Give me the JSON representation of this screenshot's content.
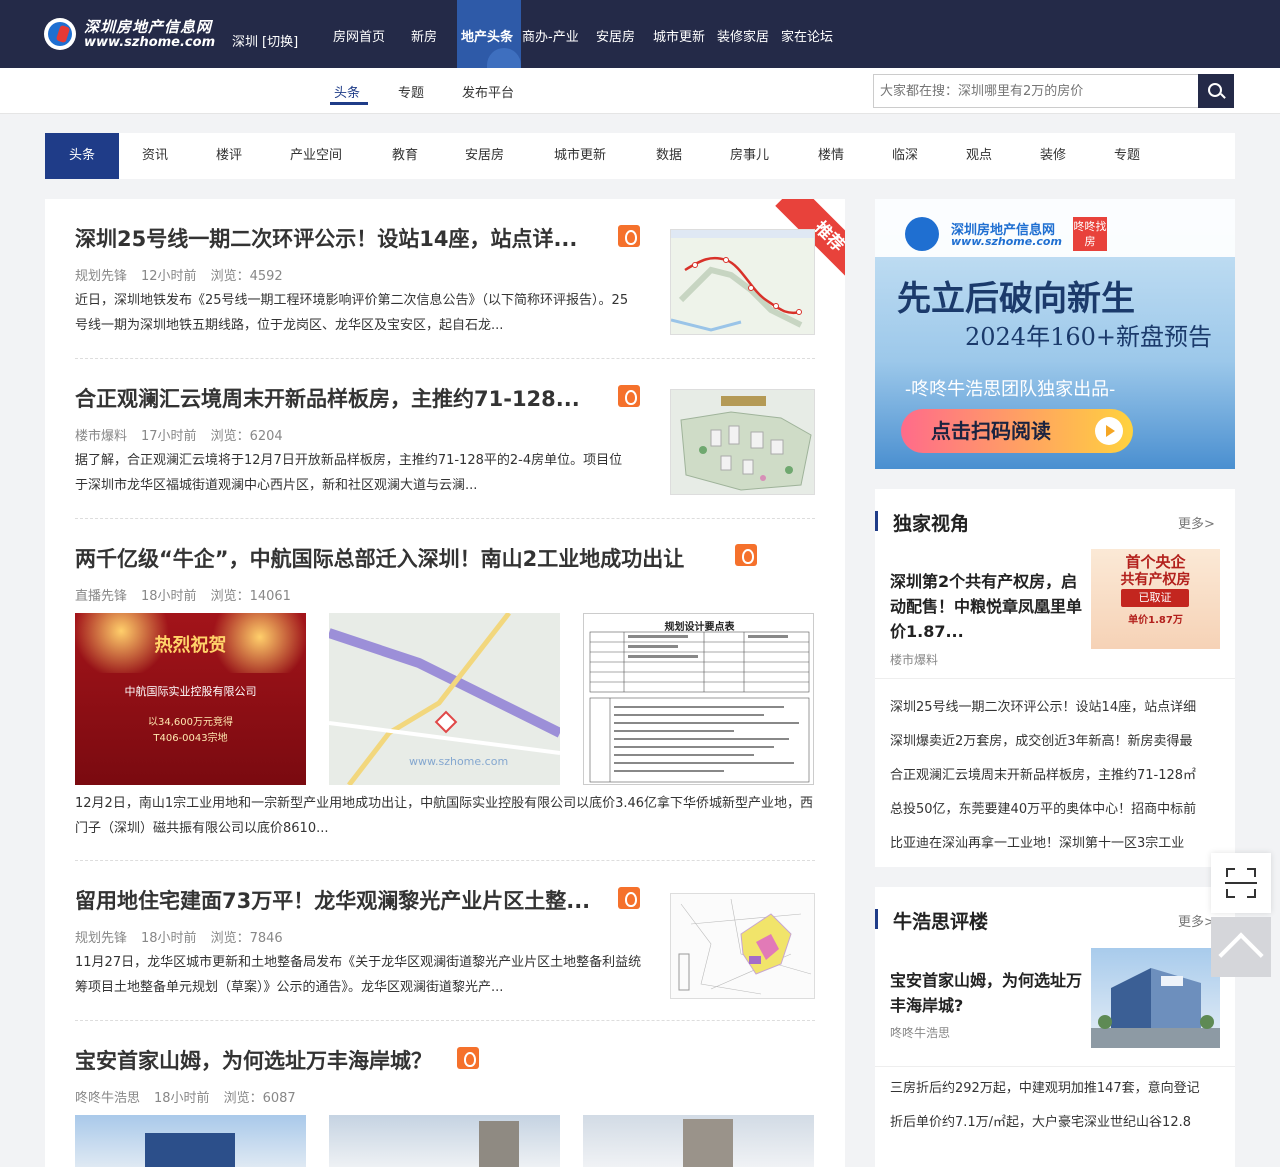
{
  "header": {
    "logo_cn": "深圳房地产信息网",
    "logo_en": "www.szhome.com",
    "city": "深圳",
    "city_switch": "[切换]",
    "nav": [
      "房网首页",
      "新房",
      "地产头条",
      "商办-产业",
      "安居房",
      "城市更新",
      "装修家居",
      "家在论坛"
    ],
    "active_nav": "地产头条"
  },
  "subnav": {
    "items": [
      "头条",
      "专题",
      "发布平台"
    ],
    "active": "头条",
    "search_placeholder": "大家都在搜：深圳哪里有2万的房价"
  },
  "categories": [
    "头条",
    "资讯",
    "楼评",
    "产业空间",
    "教育",
    "安居房",
    "城市更新",
    "数据",
    "房事儿",
    "楼情",
    "临深",
    "观点",
    "装修",
    "专题"
  ],
  "articles": [
    {
      "title": "深圳25号线一期二次环评公示！设站14座，站点详...",
      "source": "规划先锋",
      "time": "12小时前",
      "views": "浏览：4592",
      "summary": "近日，深圳地铁发布《25号线一期工程环境影响评价第二次信息公告》（以下简称环评报告）。25号线一期为深圳地铁五期线路，位于龙岗区、龙华区及宝安区，起自石龙...",
      "ribbon": "推荐"
    },
    {
      "title": "合正观澜汇云境周末开新品样板房，主推约71-128...",
      "source": "楼市爆料",
      "time": "17小时前",
      "views": "浏览：6204",
      "summary": "据了解，合正观澜汇云境将于12月7日开放新品样板房，主推约71-128平的2-4房单位。项目位于深圳市龙华区福城街道观澜中心西片区，新和社区观澜大道与云澜..."
    },
    {
      "title": "两千亿级“牛企”，中航国际总部迁入深圳！南山2工业地成功出让",
      "source": "直播先锋",
      "time": "18小时前",
      "views": "浏览：14061",
      "summary": "12月2日，南山1宗工业用地和一宗新型产业用地成功出让，中航国际实业控股有限公司以底价3.46亿拿下华侨城新型产业地，西门子（深圳）磁共振有限公司以底价8610...",
      "img1_lines": [
        "热烈祝贺",
        "中航国际实业控股有限公司",
        "以34,600万元竞得",
        "T406-0043宗地"
      ],
      "img2_watermark": "www.szhome.com",
      "img3_title": "规划设计要点表"
    },
    {
      "title": "留用地住宅建面73万平！龙华观澜黎光产业片区土整...",
      "source": "规划先锋",
      "time": "18小时前",
      "views": "浏览：7846",
      "summary": "11月27日，龙华区城市更新和土地整备局发布《关于龙华区观澜街道黎光产业片区土地整备利益统筹项目土地整备单元规划（草案）》公示的通告》。龙华区观澜街道黎光产..."
    },
    {
      "title": "宝安首家山姆，为何选址万丰海岸城？",
      "source": "咚咚牛浩思",
      "time": "18小时前",
      "views": "浏览：6087"
    }
  ],
  "banner": {
    "logo_cn": "深圳房地产信息网",
    "logo_en": "www.szhome.com",
    "tag": "咚咚找房",
    "headline": "先立后破向新生",
    "subheadline": "2024年160+新盘预告",
    "byline": "-咚咚牛浩思团队独家出品-",
    "cta": "点击扫码阅读"
  },
  "panel_exclusive": {
    "title": "独家视角",
    "more": "更多>",
    "feature_title": "深圳第2个共有产权房，启动配售！中粮悦章凤凰里单价1.87...",
    "feature_source": "楼市爆料",
    "feature_img_lines": [
      "首个央企",
      "共有产权房",
      "已取证",
      "单价1.87万"
    ],
    "links": [
      "深圳25号线一期二次环评公示！设站14座，站点详细",
      "深圳爆卖近2万套房，成交创近3年新高！新房卖得最",
      "合正观澜汇云境周末开新品样板房，主推约71-128㎡",
      "总投50亿，东莞要建40万平的奥体中心！招商中标前",
      "比亚迪在深汕再拿一工业地！深圳第十一区3宗工业"
    ]
  },
  "panel_review": {
    "title": "牛浩思评楼",
    "more": "更多>",
    "feature_title": "宝安首家山姆，为何选址万丰海岸城?",
    "feature_source": "咚咚牛浩思",
    "links": [
      "三房折后约292万起，中建观玥加推147套，意向登记",
      "折后单价约7.1万/㎡起，大户豪宅深业世纪山谷12.8"
    ]
  },
  "colors": {
    "topbar": "#242a48",
    "accent": "#1f3c88",
    "hot": "#f5712c",
    "ribbon": "#e8423b"
  }
}
